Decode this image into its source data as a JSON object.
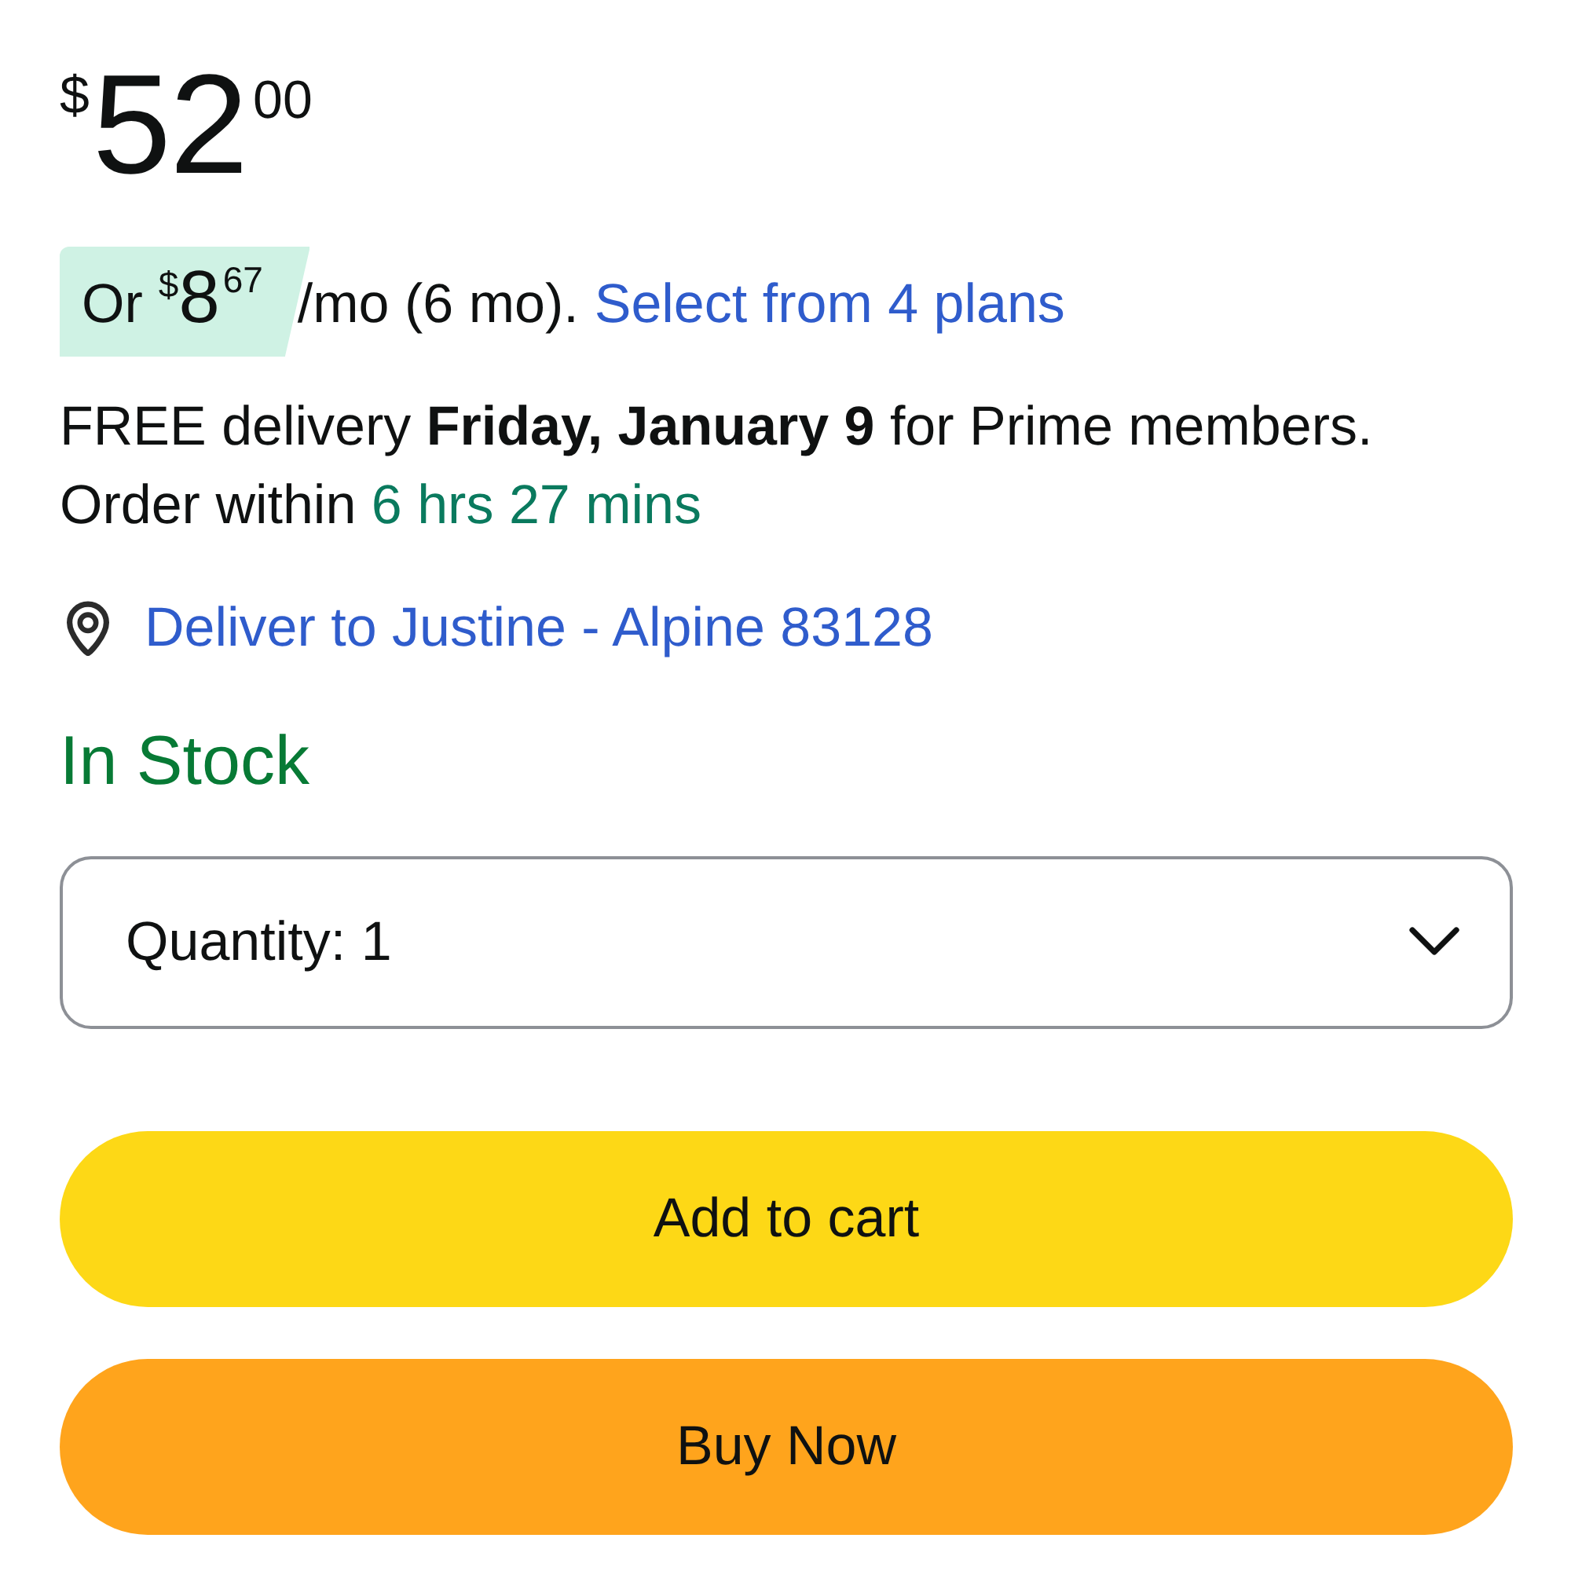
{
  "price": {
    "currency": "$",
    "whole": "52",
    "fraction": "00"
  },
  "installment": {
    "prefix": "Or",
    "currency": "$",
    "whole": "8",
    "fraction": "67",
    "terms": "/mo (6 mo).",
    "link": "Select from 4 plans"
  },
  "delivery": {
    "message": "FREE delivery **Friday, January 9** for Prime members.",
    "countdown_label": "Order within",
    "countdown": "6 hrs 27 mins"
  },
  "location": {
    "link": "Deliver to Justine - Alpine 83128"
  },
  "availability": {
    "text": "In Stock"
  },
  "quantity": {
    "label": "Quantity:",
    "value": "1"
  },
  "buttons": [
    {
      "kind": "add_to_cart",
      "label": "Add to cart"
    },
    {
      "kind": "buy_now",
      "label": "Buy Now"
    }
  ]
}
